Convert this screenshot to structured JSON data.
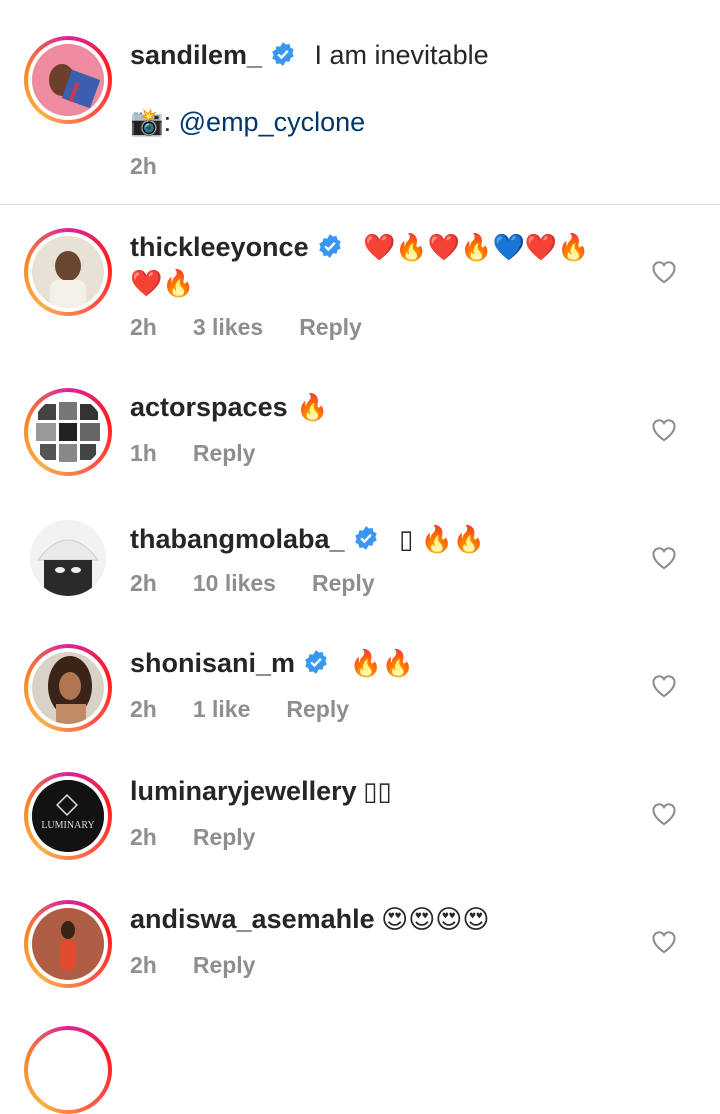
{
  "caption": {
    "username": "sandilem_",
    "text": "I am inevitable",
    "camera_emoji": "📸",
    "credit_prefix": ": ",
    "mention": "@emp_cyclone",
    "time": "2h"
  },
  "comments": [
    {
      "username": "thickleeyonce",
      "text": "❤️🔥❤️🔥💙❤️🔥",
      "text2": "❤️🔥",
      "time": "2h",
      "likes": "3 likes",
      "reply": "Reply"
    },
    {
      "username": "actorspaces",
      "text": "🔥",
      "time": "1h",
      "likes": "",
      "reply": "Reply"
    },
    {
      "username": "thabangmolaba_",
      "text": "▯ 🔥🔥",
      "time": "2h",
      "likes": "10 likes",
      "reply": "Reply"
    },
    {
      "username": "shonisani_m",
      "text": "🔥🔥",
      "time": "2h",
      "likes": "1 like",
      "reply": "Reply"
    },
    {
      "username": "luminaryjewellery",
      "text": "▯▯",
      "time": "2h",
      "likes": "",
      "reply": "Reply"
    },
    {
      "username": "andiswa_asemahle",
      "text": "😍😍😍😍",
      "time": "2h",
      "likes": "",
      "reply": "Reply"
    }
  ],
  "avatar_logo_text": "LUMINARY",
  "colors": {
    "verified": "#3897f0",
    "link": "#00376b",
    "meta": "#8e8e8e",
    "divider": "#dbdbdb"
  }
}
